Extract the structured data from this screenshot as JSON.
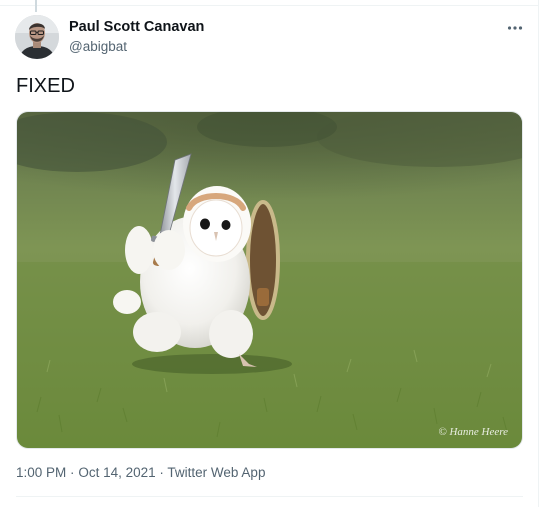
{
  "author": {
    "display_name": "Paul Scott Canavan",
    "handle": "@abigbat",
    "avatar_icon": "profile-photo"
  },
  "tweet": {
    "text": "FIXED",
    "media": {
      "kind": "photo",
      "watermark": "© Hanne Heere"
    },
    "time": "1:00 PM",
    "separator": "·",
    "date": "Oct 14, 2021",
    "source": "Twitter Web App"
  },
  "icons": {
    "more": "more-horizontal-icon"
  },
  "colors": {
    "text_primary": "#0f1419",
    "text_secondary": "#536471",
    "divider": "#eff3f4"
  }
}
